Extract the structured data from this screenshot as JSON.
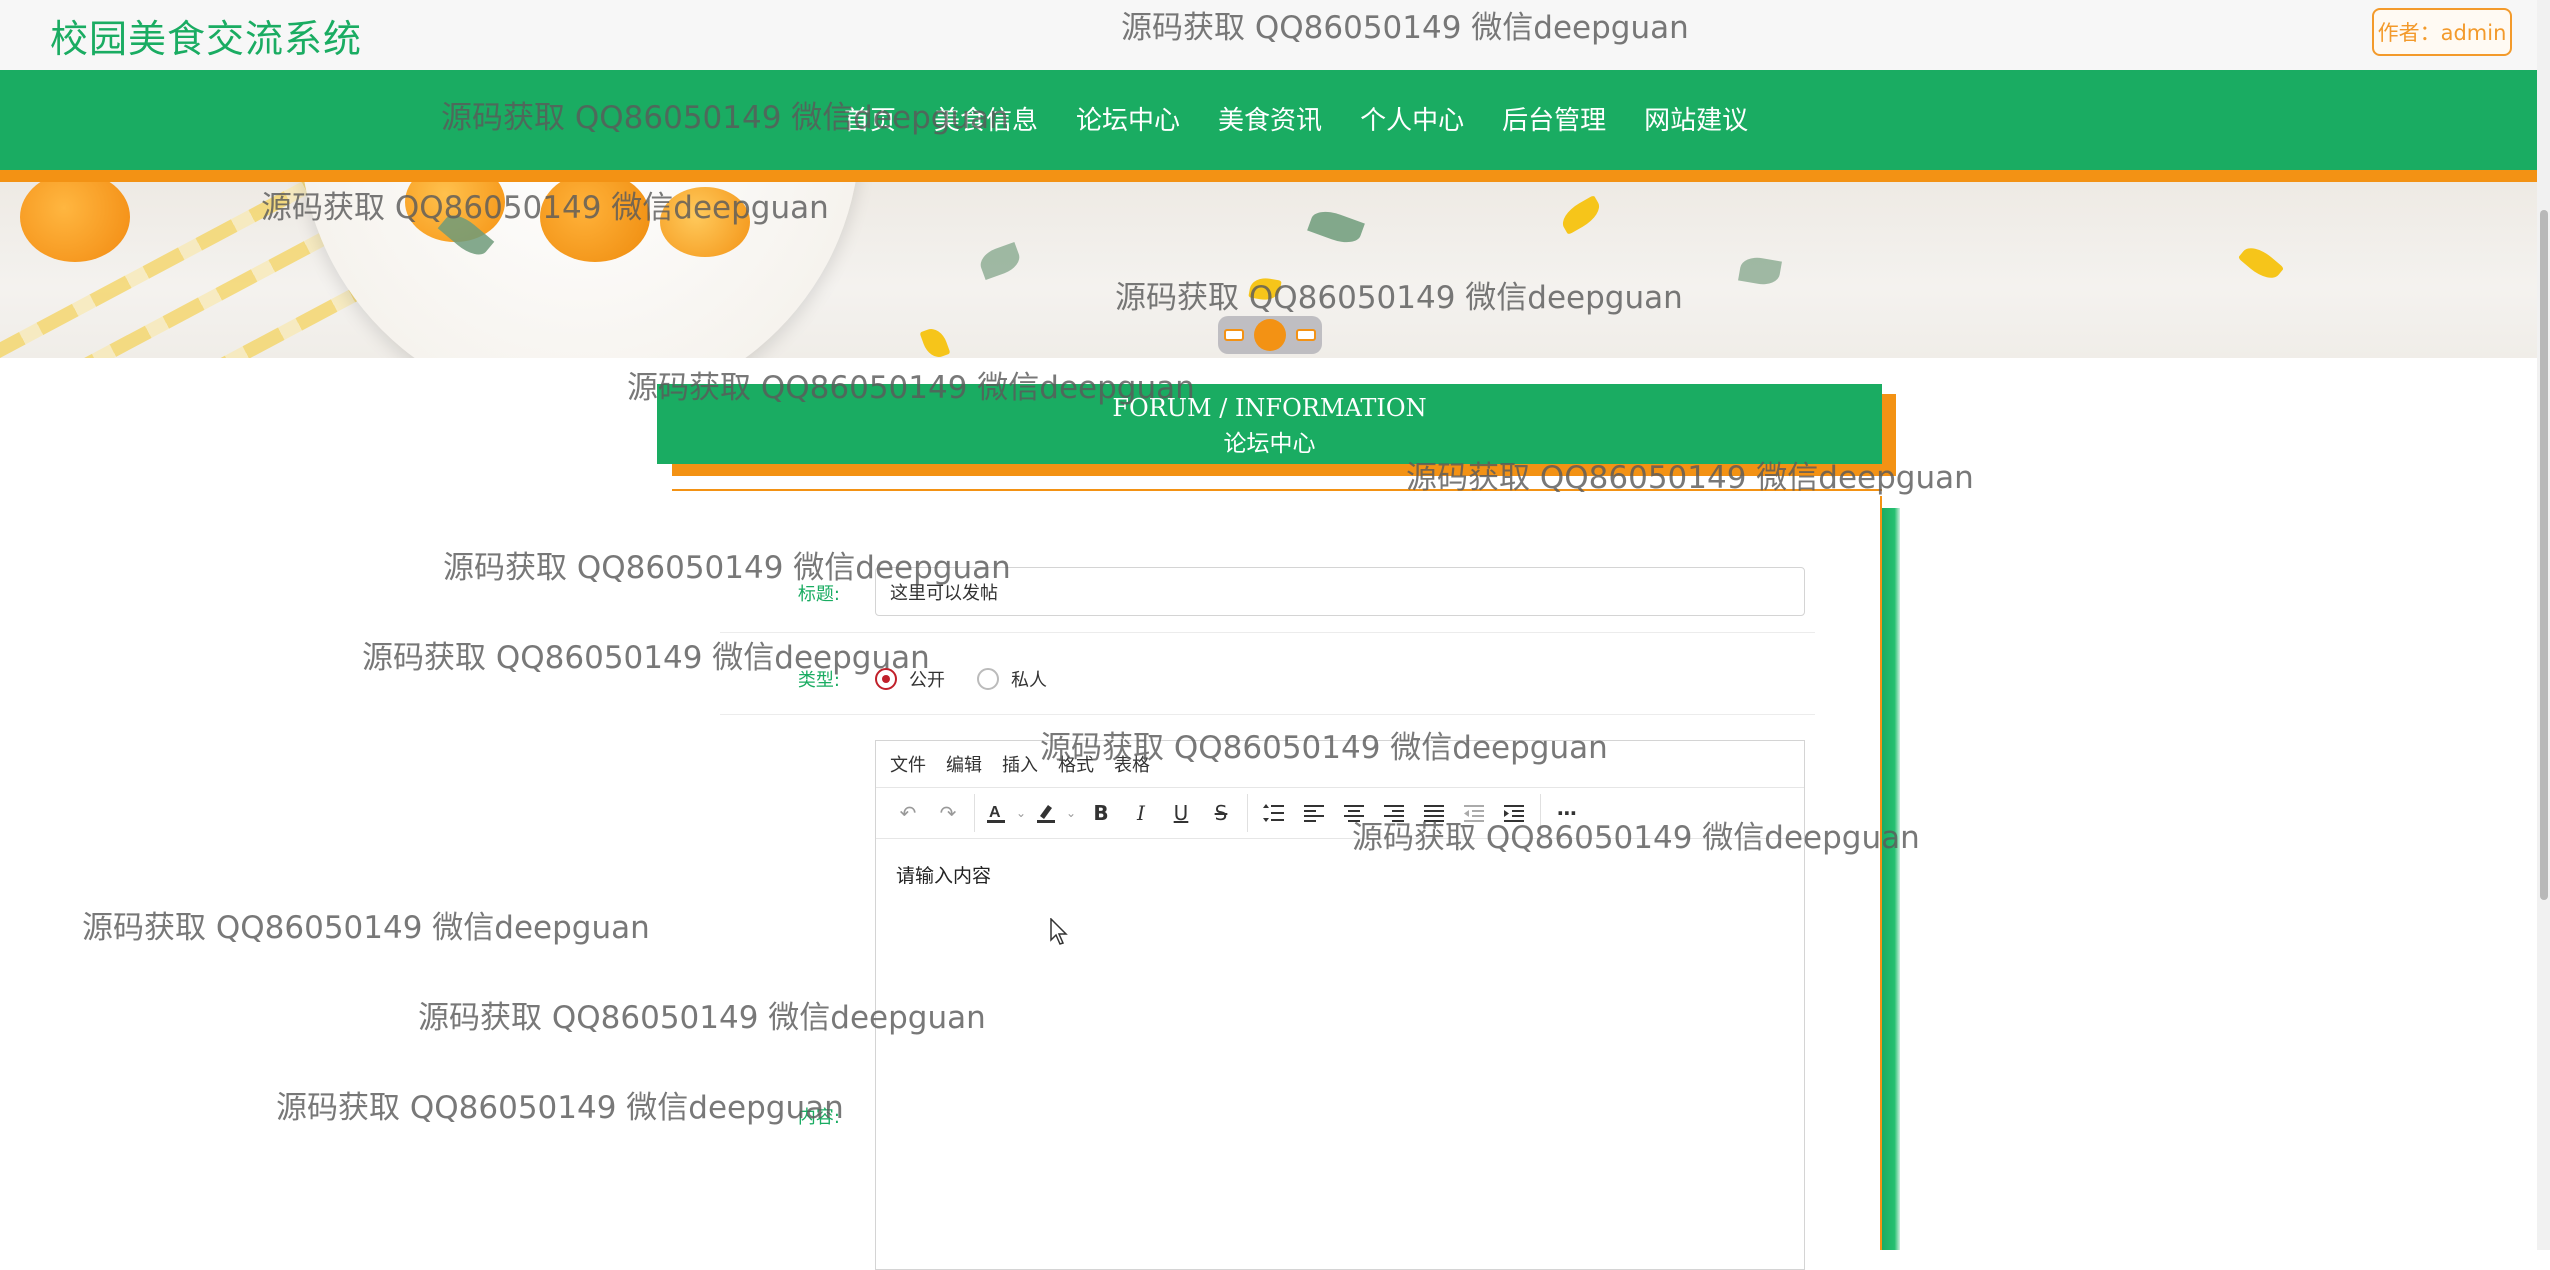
{
  "header": {
    "site_title": "校园美食交流系统",
    "author_badge": "作者：admin"
  },
  "nav": {
    "items": [
      "首页",
      "美食信息",
      "论坛中心",
      "美食资讯",
      "个人中心",
      "后台管理",
      "网站建议"
    ]
  },
  "section": {
    "title_en": "FORUM / INFORMATION",
    "title_cn": "论坛中心"
  },
  "form": {
    "title_label": "标题:",
    "title_value": "这里可以发帖",
    "type_label": "类型:",
    "type_options": [
      "公开",
      "私人"
    ],
    "type_selected": "公开",
    "content_label": "内容:"
  },
  "editor": {
    "menus": [
      "文件",
      "编辑",
      "插入",
      "格式",
      "表格"
    ],
    "placeholder": "请输入内容"
  },
  "watermark": {
    "text": "源码获取 QQ86050149 微信deepguan"
  },
  "colors": {
    "primary_green": "#1aac62",
    "accent_orange": "#f39214"
  }
}
